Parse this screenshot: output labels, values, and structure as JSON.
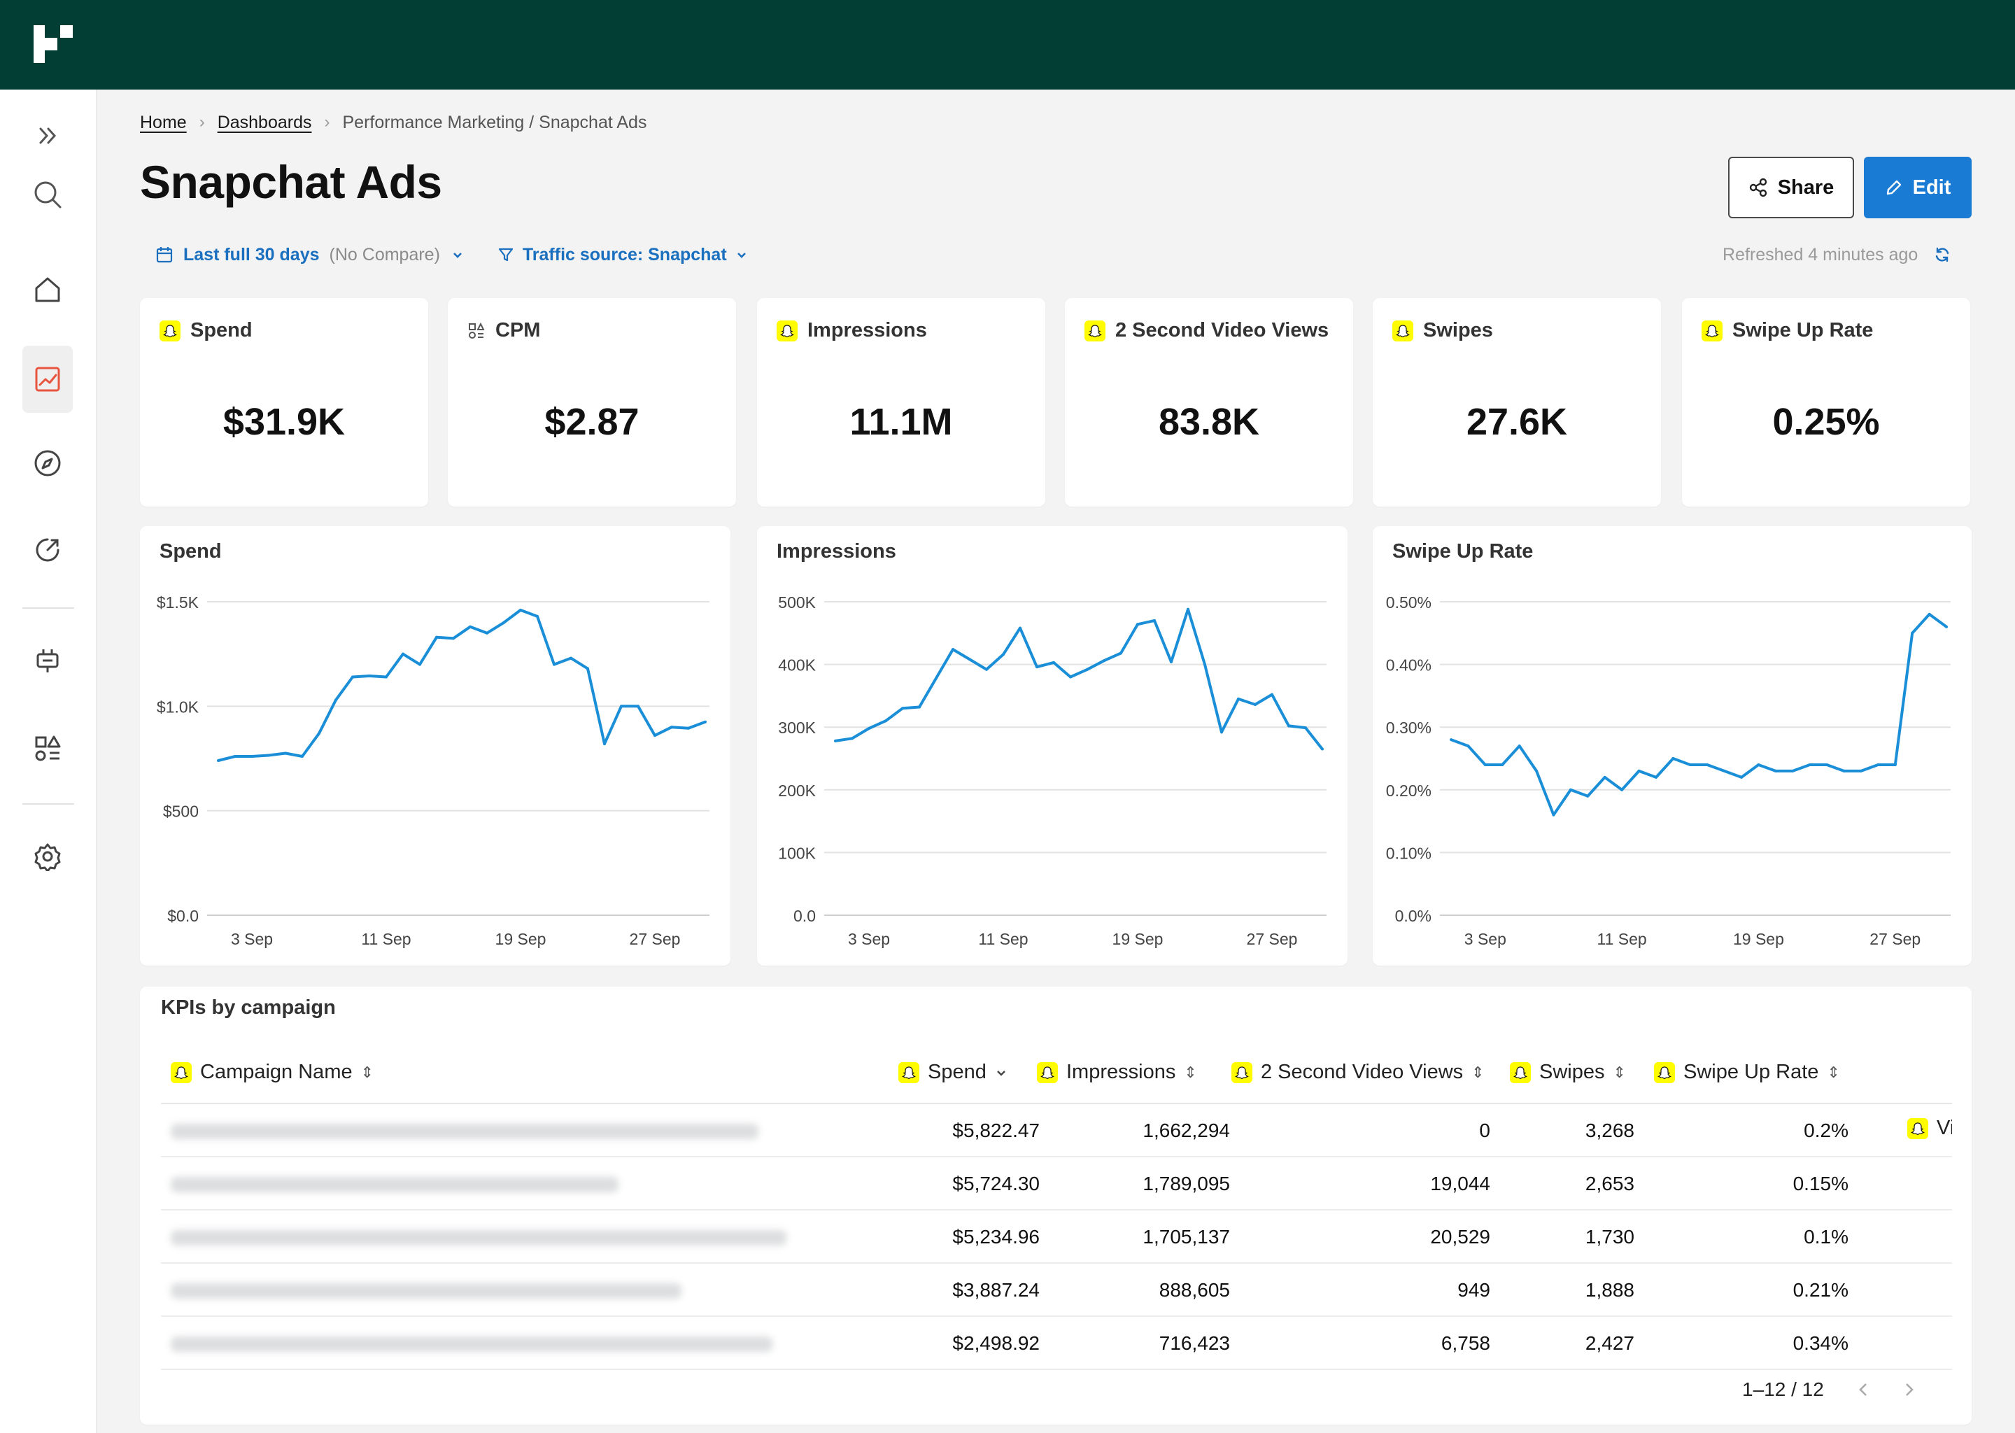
{
  "colors": {
    "topbar": "#023e33",
    "accent": "#1a7bd4",
    "link": "#1a6fbf",
    "line": "#1a8fd8",
    "snapchat_yellow": "#fffc00",
    "active_icon": "#e8553e"
  },
  "sidebar": {
    "icons": [
      "expand-icon",
      "search-icon",
      "home-icon",
      "chart-icon",
      "compass-icon",
      "goal-icon",
      "plug-icon",
      "shapes-icon",
      "gear-icon"
    ]
  },
  "breadcrumb": {
    "home": "Home",
    "dashboards": "Dashboards",
    "current": "Performance Marketing / Snapchat Ads"
  },
  "page": {
    "title": "Snapchat Ads"
  },
  "actions": {
    "share": "Share",
    "edit": "Edit"
  },
  "filters": {
    "date_range": "Last full 30 days",
    "compare": "(No Compare)",
    "traffic": "Traffic source: Snapchat",
    "refreshed": "Refreshed 4 minutes ago"
  },
  "kpis": [
    {
      "label": "Spend",
      "value": "$31.9K",
      "icon": "snapchat-icon"
    },
    {
      "label": "CPM",
      "value": "$2.87",
      "icon": "formula-icon"
    },
    {
      "label": "Impressions",
      "value": "11.1M",
      "icon": "snapchat-icon"
    },
    {
      "label": "2 Second Video Views",
      "value": "83.8K",
      "icon": "snapchat-icon"
    },
    {
      "label": "Swipes",
      "value": "27.6K",
      "icon": "snapchat-icon"
    },
    {
      "label": "Swipe Up Rate",
      "value": "0.25%",
      "icon": "snapchat-icon"
    }
  ],
  "chart_data": [
    {
      "type": "line",
      "title": "Spend",
      "x_ticks": [
        "3 Sep",
        "11 Sep",
        "19 Sep",
        "27 Sep"
      ],
      "y_ticks": [
        "$0.0",
        "$500",
        "$1.0K",
        "$1.5K"
      ],
      "ylim": [
        0,
        1500
      ],
      "x": [
        "1 Sep",
        "2 Sep",
        "3 Sep",
        "4 Sep",
        "5 Sep",
        "6 Sep",
        "7 Sep",
        "8 Sep",
        "9 Sep",
        "10 Sep",
        "11 Sep",
        "12 Sep",
        "13 Sep",
        "14 Sep",
        "15 Sep",
        "16 Sep",
        "17 Sep",
        "18 Sep",
        "19 Sep",
        "20 Sep",
        "21 Sep",
        "22 Sep",
        "23 Sep",
        "24 Sep",
        "25 Sep",
        "26 Sep",
        "27 Sep",
        "28 Sep",
        "29 Sep",
        "30 Sep"
      ],
      "values": [
        740,
        760,
        760,
        765,
        775,
        760,
        870,
        1030,
        1140,
        1145,
        1140,
        1250,
        1200,
        1330,
        1325,
        1380,
        1350,
        1400,
        1460,
        1430,
        1200,
        1230,
        1180,
        820,
        1000,
        1000,
        860,
        900,
        895,
        925
      ],
      "grid": true
    },
    {
      "type": "line",
      "title": "Impressions",
      "x_ticks": [
        "3 Sep",
        "11 Sep",
        "19 Sep",
        "27 Sep"
      ],
      "y_ticks": [
        "0.0",
        "100K",
        "200K",
        "300K",
        "400K",
        "500K"
      ],
      "ylim": [
        0,
        500000
      ],
      "x": [
        "1 Sep",
        "2 Sep",
        "3 Sep",
        "4 Sep",
        "5 Sep",
        "6 Sep",
        "7 Sep",
        "8 Sep",
        "9 Sep",
        "10 Sep",
        "11 Sep",
        "12 Sep",
        "13 Sep",
        "14 Sep",
        "15 Sep",
        "16 Sep",
        "17 Sep",
        "18 Sep",
        "19 Sep",
        "20 Sep",
        "21 Sep",
        "22 Sep",
        "23 Sep",
        "24 Sep",
        "25 Sep",
        "26 Sep",
        "27 Sep",
        "28 Sep",
        "29 Sep",
        "30 Sep"
      ],
      "values": [
        278000,
        282000,
        298000,
        310000,
        330000,
        332000,
        378000,
        424000,
        408000,
        392000,
        416000,
        458000,
        396000,
        403000,
        380000,
        392000,
        406000,
        418000,
        464000,
        470000,
        404000,
        488000,
        400000,
        292000,
        345000,
        336000,
        352000,
        302000,
        299000,
        265000
      ],
      "grid": true
    },
    {
      "type": "line",
      "title": "Swipe Up Rate",
      "x_ticks": [
        "3 Sep",
        "11 Sep",
        "19 Sep",
        "27 Sep"
      ],
      "y_ticks": [
        "0.0%",
        "0.10%",
        "0.20%",
        "0.30%",
        "0.40%",
        "0.50%"
      ],
      "ylim": [
        0,
        0.5
      ],
      "x": [
        "1 Sep",
        "2 Sep",
        "3 Sep",
        "4 Sep",
        "5 Sep",
        "6 Sep",
        "7 Sep",
        "8 Sep",
        "9 Sep",
        "10 Sep",
        "11 Sep",
        "12 Sep",
        "13 Sep",
        "14 Sep",
        "15 Sep",
        "16 Sep",
        "17 Sep",
        "18 Sep",
        "19 Sep",
        "20 Sep",
        "21 Sep",
        "22 Sep",
        "23 Sep",
        "24 Sep",
        "25 Sep",
        "26 Sep",
        "27 Sep",
        "28 Sep",
        "29 Sep",
        "30 Sep",
        "1 Oct",
        "2 Oct",
        "3 Oct"
      ],
      "values": [
        0.28,
        0.27,
        0.24,
        0.24,
        0.27,
        0.23,
        0.16,
        0.2,
        0.19,
        0.22,
        0.2,
        0.23,
        0.22,
        0.25,
        0.24,
        0.24,
        0.23,
        0.22,
        0.24,
        0.23,
        0.23,
        0.24,
        0.24,
        0.23,
        0.23,
        0.24,
        0.24,
        0.45,
        0.48,
        0.46
      ],
      "grid": true
    }
  ],
  "table": {
    "title": "KPIs by campaign",
    "columns": [
      "Campaign Name",
      "Spend",
      "Impressions",
      "2 Second Video Views",
      "Swipes",
      "Swipe Up Rate",
      "View"
    ],
    "rows": [
      {
        "spend": "$5,822.47",
        "impressions": "1,662,294",
        "views": "0",
        "swipes": "3,268",
        "rate": "0.2%"
      },
      {
        "spend": "$5,724.30",
        "impressions": "1,789,095",
        "views": "19,044",
        "swipes": "2,653",
        "rate": "0.15%"
      },
      {
        "spend": "$5,234.96",
        "impressions": "1,705,137",
        "views": "20,529",
        "swipes": "1,730",
        "rate": "0.1%"
      },
      {
        "spend": "$3,887.24",
        "impressions": "888,605",
        "views": "949",
        "swipes": "1,888",
        "rate": "0.21%"
      },
      {
        "spend": "$2,498.92",
        "impressions": "716,423",
        "views": "6,758",
        "swipes": "2,427",
        "rate": "0.34%"
      }
    ],
    "pagination": "1–12 / 12"
  }
}
